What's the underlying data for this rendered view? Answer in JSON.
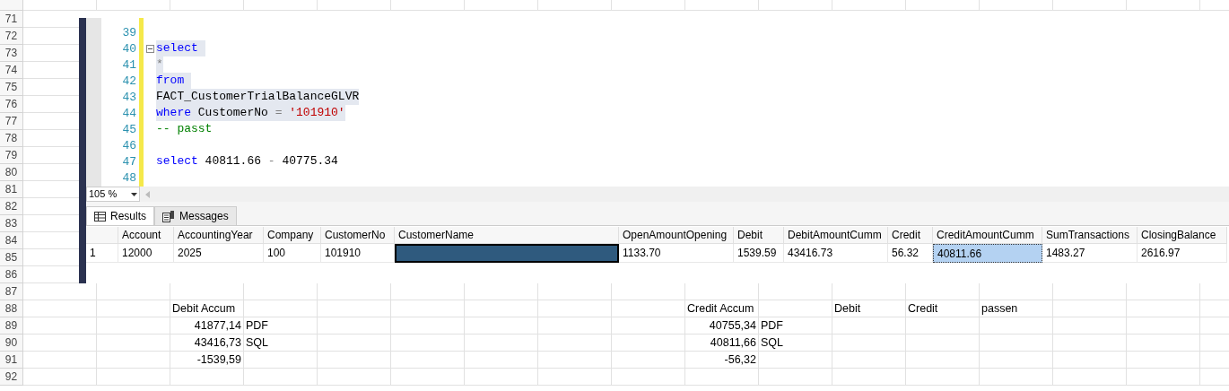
{
  "spreadsheet": {
    "rows": [
      {
        "cells": {}
      },
      {
        "number": "71",
        "cells": {}
      },
      {
        "number": "72",
        "cells": {}
      },
      {
        "number": "73",
        "cells": {}
      },
      {
        "number": "74",
        "cells": {}
      },
      {
        "number": "75",
        "cells": {}
      },
      {
        "number": "76",
        "cells": {}
      },
      {
        "number": "77",
        "cells": {}
      },
      {
        "number": "78",
        "cells": {}
      },
      {
        "number": "79",
        "cells": {}
      },
      {
        "number": "80",
        "cells": {}
      },
      {
        "number": "81",
        "cells": {}
      },
      {
        "number": "82",
        "cells": {}
      },
      {
        "number": "83",
        "cells": {}
      },
      {
        "number": "84",
        "cells": {}
      },
      {
        "number": "85",
        "cells": {}
      },
      {
        "number": "86",
        "cells": {}
      },
      {
        "number": "87",
        "cells": {}
      },
      {
        "number": "88",
        "cells": {
          "column_3": {
            "text": "Debit Accum",
            "kind": "text"
          },
          "column_10": {
            "text": "Credit Accum",
            "kind": "text"
          },
          "column_12": {
            "text": "Debit",
            "kind": "text"
          },
          "column_13": {
            "text": "Credit",
            "kind": "text"
          },
          "column_14": {
            "text": "passen",
            "kind": "text"
          }
        }
      },
      {
        "number": "89",
        "cells": {
          "column_3": {
            "text": "41877,14",
            "kind": "number"
          },
          "column_4": {
            "text": "PDF",
            "kind": "text"
          },
          "column_10": {
            "text": "40755,34",
            "kind": "number"
          },
          "column_11": {
            "text": "PDF",
            "kind": "text"
          }
        }
      },
      {
        "number": "90",
        "cells": {
          "column_3": {
            "text": "43416,73",
            "kind": "number"
          },
          "column_4": {
            "text": "SQL",
            "kind": "text"
          },
          "column_10": {
            "text": "40811,66",
            "kind": "number"
          },
          "column_11": {
            "text": "SQL",
            "kind": "text"
          }
        }
      },
      {
        "number": "91",
        "cells": {
          "column_3": {
            "text": "-1539,59",
            "kind": "number"
          },
          "column_10": {
            "text": "-56,32",
            "kind": "number"
          }
        }
      },
      {
        "number": "92",
        "cells": {}
      }
    ]
  },
  "query_window": {
    "code_lines": [
      {
        "number": "39"
      },
      {
        "number": "40",
        "selected": true,
        "collapsible": true,
        "tokens": [
          {
            "text": "select ",
            "kind": "keyword"
          }
        ]
      },
      {
        "number": "41",
        "selected": true,
        "tokens": [
          {
            "text": "*",
            "kind": "operator"
          }
        ]
      },
      {
        "number": "42",
        "selected": true,
        "tokens": [
          {
            "text": "from ",
            "kind": "keyword"
          }
        ]
      },
      {
        "number": "43",
        "selected": true,
        "tokens": [
          {
            "text": "FACT_CustomerTrialBalanceGLVR",
            "kind": "plain"
          }
        ]
      },
      {
        "number": "44",
        "selected": true,
        "tokens": [
          {
            "text": "where",
            "kind": "keyword"
          },
          {
            "text": " CustomerNo",
            "kind": "plain"
          },
          {
            "text": " = ",
            "kind": "operator"
          },
          {
            "text": "'101910'",
            "kind": "string"
          }
        ]
      },
      {
        "number": "45",
        "selected": false,
        "tokens": [
          {
            "text": "-- passt",
            "kind": "comment"
          }
        ]
      },
      {
        "number": "46"
      },
      {
        "number": "47",
        "selected": false,
        "tokens": [
          {
            "text": "select",
            "kind": "keyword"
          },
          {
            "text": " 40811.66",
            "kind": "plain"
          },
          {
            "text": " - ",
            "kind": "operator"
          },
          {
            "text": "40775.34",
            "kind": "plain"
          }
        ]
      },
      {
        "number": "48"
      }
    ],
    "zoom": "105 %",
    "tabs": [
      {
        "label": "Results",
        "selected": true
      },
      {
        "label": "Messages",
        "selected": false
      }
    ],
    "results": {
      "columns": [
        {},
        {
          "label": "Account"
        },
        {
          "label": "AccountingYear"
        },
        {
          "label": "Company"
        },
        {
          "label": "CustomerNo"
        },
        {
          "label": "CustomerName"
        },
        {
          "label": "OpenAmountOpening"
        },
        {
          "label": "Debit"
        },
        {
          "label": "DebitAmountCumm"
        },
        {
          "label": "Credit"
        },
        {
          "label": "CreditAmountCumm"
        },
        {
          "label": "SumTransactions"
        },
        {
          "label": "ClosingBalance"
        }
      ],
      "rows": [
        {
          "cells": [
            {
              "text": "1"
            },
            {
              "text": "12000"
            },
            {
              "text": "2025"
            },
            {
              "text": "100"
            },
            {
              "text": "101910"
            },
            {
              "redacted": true
            },
            {
              "text": "1133.70"
            },
            {
              "text": "1539.59"
            },
            {
              "text": "43416.73"
            },
            {
              "text": "56.32"
            },
            {
              "text": "40811.66",
              "selected": true
            },
            {
              "text": "1483.27"
            },
            {
              "text": "2616.97"
            }
          ]
        }
      ]
    }
  }
}
